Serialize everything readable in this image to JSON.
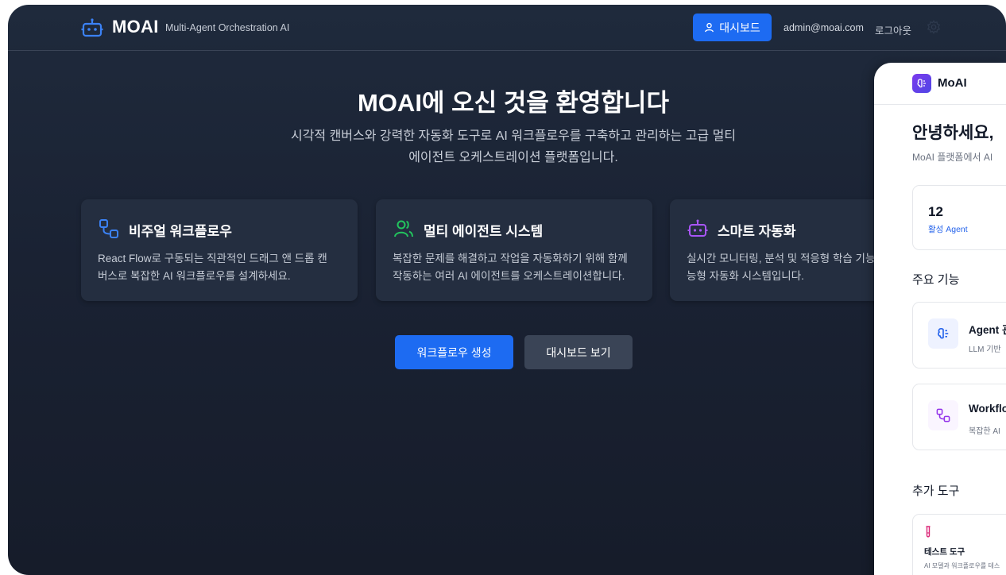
{
  "header": {
    "brand": "MOAI",
    "tagline": "Multi-Agent Orchestration AI",
    "dashboard_label": "대시보드",
    "user_email": "admin@moai.com",
    "logout_label": "로그아웃",
    "icons": [
      "robot-logo-icon",
      "user-icon",
      "gear-icon"
    ]
  },
  "hero": {
    "title": "MOAI에 오신 것을 환영합니다",
    "subtitle_line1": "시각적 캔버스와 강력한 자동화 도구로 AI 워크플로우를 구축하고 관리하는 고급 멀티",
    "subtitle_line2": "에이전트 오케스트레이션 플랫폼입니다."
  },
  "features": [
    {
      "title": "비주얼 워크플로우",
      "desc_line1": "React Flow로 구동되는 직관적인 드래그 앤 드롭 캔",
      "desc_line2": "버스로 복잡한 AI 워크플로우를 설계하세요.",
      "icon": "workflow-icon"
    },
    {
      "title": "멀티 에이전트 시스템",
      "desc_line1": "복잡한 문제를 해결하고 작업을 자동화하기 위해 함께",
      "desc_line2": "작동하는 여러 AI 에이전트를 오케스트레이션합니다.",
      "icon": "users-icon"
    },
    {
      "title": "스마트 자동화",
      "desc_line1": "실시간 모니터링, 분석 및 적응형 학습 기능",
      "desc_line2": "능형 자동화 시스템입니다.",
      "icon": "robot-icon"
    }
  ],
  "actions": {
    "create_workflow": "워크플로우 생성",
    "view_dashboard": "대시보드 보기"
  },
  "mobile": {
    "brand": "MoAI",
    "greeting": "안녕하세요,",
    "subtext": "MoAI 플랫폼에서 AI",
    "stat": {
      "value": "12",
      "label": "활성 Agent"
    },
    "section_features": "주요 기능",
    "feature_cards": [
      {
        "title": "Agent 관",
        "sub": "LLM 기반",
        "icon": "brain-icon"
      },
      {
        "title": "Workflo",
        "sub": "복잡한 AI",
        "icon": "workflow-icon"
      }
    ],
    "section_tools": "추가 도구",
    "tool": {
      "title": "테스트 도구",
      "desc": "AI 모델과 워크플로우를 테스",
      "icon": "test-tube-icon"
    }
  },
  "colors": {
    "accent": "#1d6bf2",
    "background": "#1a2233",
    "card": "#242e40",
    "workflow_icon": "#3b82f6",
    "users_icon": "#22c55e",
    "robot_icon": "#a855f7"
  }
}
